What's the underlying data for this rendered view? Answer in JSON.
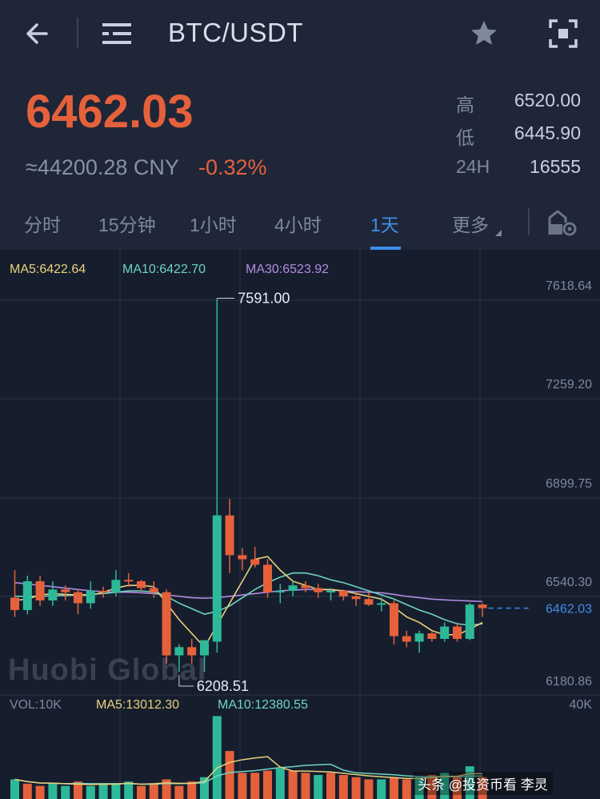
{
  "header": {
    "pair": "BTC/USDT",
    "icons": [
      "back-arrow-icon",
      "menu-icon",
      "star-icon",
      "fullscreen-icon"
    ]
  },
  "summary": {
    "last_price": "6462.03",
    "cny_price": "≈44200.28 CNY",
    "change_pct": "-0.32%",
    "high_label": "高",
    "high_value": "6520.00",
    "low_label": "低",
    "low_value": "6445.90",
    "vol24_label": "24H",
    "vol24_value": "16555"
  },
  "tabs": [
    {
      "label": "分时",
      "active": false
    },
    {
      "label": "15分钟",
      "active": false
    },
    {
      "label": "1小时",
      "active": false
    },
    {
      "label": "4小时",
      "active": false
    },
    {
      "label": "1天",
      "active": true
    },
    {
      "label": "更多",
      "active": false
    }
  ],
  "colors": {
    "up": "#2db998",
    "down": "#e5613b",
    "ma5": "#e8d07a",
    "ma10": "#6fd3c0",
    "ma30": "#b48ae0",
    "accent": "#3f8ee8"
  },
  "chart": {
    "ma5_label": "MA5:6422.64",
    "ma10_label": "MA10:6422.70",
    "ma30_label": "MA30:6523.92",
    "y_ticks": [
      "7618.64",
      "7259.20",
      "6899.75",
      "6540.30",
      "6180.86"
    ],
    "current_price_tag": "6462.03",
    "max_annotation": "7591.00",
    "min_annotation": "6208.51",
    "watermark": "Huobi Global",
    "vol_label": "VOL:10K",
    "vol_ma5_label": "MA5:13012.30",
    "vol_ma10_label": "MA10:12380.55",
    "vol_scale": "40K",
    "footer_tag": "头条 @投资币看 李灵"
  },
  "chart_data": {
    "type": "candlestick",
    "ylim": [
      6180.86,
      7618.64
    ],
    "candles": [
      {
        "o": 6500,
        "h": 6600,
        "l": 6430,
        "c": 6455
      },
      {
        "o": 6455,
        "h": 6580,
        "l": 6440,
        "c": 6560
      },
      {
        "o": 6560,
        "h": 6580,
        "l": 6470,
        "c": 6490
      },
      {
        "o": 6490,
        "h": 6560,
        "l": 6470,
        "c": 6530
      },
      {
        "o": 6530,
        "h": 6545,
        "l": 6490,
        "c": 6520
      },
      {
        "o": 6520,
        "h": 6530,
        "l": 6440,
        "c": 6480
      },
      {
        "o": 6480,
        "h": 6560,
        "l": 6460,
        "c": 6525
      },
      {
        "o": 6525,
        "h": 6540,
        "l": 6500,
        "c": 6520
      },
      {
        "o": 6520,
        "h": 6600,
        "l": 6505,
        "c": 6565
      },
      {
        "o": 6565,
        "h": 6590,
        "l": 6540,
        "c": 6560
      },
      {
        "o": 6560,
        "h": 6565,
        "l": 6520,
        "c": 6535
      },
      {
        "o": 6535,
        "h": 6560,
        "l": 6500,
        "c": 6520
      },
      {
        "o": 6520,
        "h": 6530,
        "l": 6260,
        "c": 6290
      },
      {
        "o": 6290,
        "h": 6330,
        "l": 6230,
        "c": 6320
      },
      {
        "o": 6320,
        "h": 6350,
        "l": 6260,
        "c": 6290
      },
      {
        "o": 6290,
        "h": 6340,
        "l": 6230,
        "c": 6345
      },
      {
        "o": 6340,
        "h": 7591,
        "l": 6300,
        "c": 6800
      },
      {
        "o": 6800,
        "h": 6860,
        "l": 6590,
        "c": 6655
      },
      {
        "o": 6655,
        "h": 6680,
        "l": 6600,
        "c": 6640
      },
      {
        "o": 6640,
        "h": 6685,
        "l": 6610,
        "c": 6620
      },
      {
        "o": 6620,
        "h": 6640,
        "l": 6500,
        "c": 6520
      },
      {
        "o": 6520,
        "h": 6550,
        "l": 6480,
        "c": 6525
      },
      {
        "o": 6525,
        "h": 6560,
        "l": 6505,
        "c": 6545
      },
      {
        "o": 6545,
        "h": 6560,
        "l": 6520,
        "c": 6535
      },
      {
        "o": 6535,
        "h": 6550,
        "l": 6500,
        "c": 6520
      },
      {
        "o": 6520,
        "h": 6535,
        "l": 6490,
        "c": 6525
      },
      {
        "o": 6525,
        "h": 6530,
        "l": 6490,
        "c": 6505
      },
      {
        "o": 6505,
        "h": 6520,
        "l": 6470,
        "c": 6495
      },
      {
        "o": 6495,
        "h": 6520,
        "l": 6470,
        "c": 6475
      },
      {
        "o": 6475,
        "h": 6500,
        "l": 6450,
        "c": 6480
      },
      {
        "o": 6480,
        "h": 6490,
        "l": 6330,
        "c": 6360
      },
      {
        "o": 6360,
        "h": 6380,
        "l": 6320,
        "c": 6340
      },
      {
        "o": 6340,
        "h": 6380,
        "l": 6300,
        "c": 6370
      },
      {
        "o": 6370,
        "h": 6375,
        "l": 6340,
        "c": 6350
      },
      {
        "o": 6350,
        "h": 6410,
        "l": 6340,
        "c": 6395
      },
      {
        "o": 6395,
        "h": 6410,
        "l": 6340,
        "c": 6350
      },
      {
        "o": 6350,
        "h": 6480,
        "l": 6345,
        "c": 6475
      },
      {
        "o": 6475,
        "h": 6480,
        "l": 6430,
        "c": 6462
      }
    ],
    "ma5": [
      6490,
      6495,
      6510,
      6515,
      6512,
      6510,
      6508,
      6520,
      6535,
      6545,
      6545,
      6540,
      6480,
      6420,
      6370,
      6320,
      6400,
      6480,
      6560,
      6640,
      6650,
      6600,
      6560,
      6545,
      6530,
      6530,
      6525,
      6515,
      6505,
      6495,
      6465,
      6430,
      6410,
      6380,
      6365,
      6365,
      6385,
      6410
    ],
    "ma10": [
      6505,
      6505,
      6505,
      6507,
      6508,
      6510,
      6512,
      6515,
      6520,
      6525,
      6525,
      6520,
      6505,
      6480,
      6460,
      6440,
      6450,
      6470,
      6500,
      6530,
      6555,
      6575,
      6590,
      6590,
      6580,
      6565,
      6555,
      6540,
      6525,
      6510,
      6495,
      6475,
      6455,
      6440,
      6420,
      6405,
      6400,
      6405
    ],
    "ma30": [
      6555,
      6550,
      6545,
      6540,
      6535,
      6530,
      6525,
      6522,
      6520,
      6520,
      6518,
      6515,
      6510,
      6505,
      6500,
      6498,
      6500,
      6505,
      6510,
      6515,
      6520,
      6525,
      6528,
      6530,
      6530,
      6528,
      6525,
      6522,
      6520,
      6518,
      6512,
      6505,
      6500,
      6495,
      6492,
      6490,
      6488,
      6486
    ],
    "volumes": [
      {
        "v": 9,
        "up": true
      },
      {
        "v": 7,
        "up": false
      },
      {
        "v": 6,
        "up": false
      },
      {
        "v": 7,
        "up": true
      },
      {
        "v": 6,
        "up": true
      },
      {
        "v": 8,
        "up": false
      },
      {
        "v": 6,
        "up": true
      },
      {
        "v": 7,
        "up": true
      },
      {
        "v": 7,
        "up": true
      },
      {
        "v": 8,
        "up": true
      },
      {
        "v": 6,
        "up": false
      },
      {
        "v": 7,
        "up": false
      },
      {
        "v": 9,
        "up": false
      },
      {
        "v": 6,
        "up": false
      },
      {
        "v": 8,
        "up": false
      },
      {
        "v": 10,
        "up": true
      },
      {
        "v": 38,
        "up": true
      },
      {
        "v": 22,
        "up": false
      },
      {
        "v": 12,
        "up": false
      },
      {
        "v": 12,
        "up": false
      },
      {
        "v": 13,
        "up": false
      },
      {
        "v": 14,
        "up": true
      },
      {
        "v": 13,
        "up": false
      },
      {
        "v": 12,
        "up": false
      },
      {
        "v": 11,
        "up": true
      },
      {
        "v": 12,
        "up": false
      },
      {
        "v": 11,
        "up": false
      },
      {
        "v": 10,
        "up": false
      },
      {
        "v": 9,
        "up": false
      },
      {
        "v": 9,
        "up": true
      },
      {
        "v": 10,
        "up": false
      },
      {
        "v": 9,
        "up": false
      },
      {
        "v": 10,
        "up": true
      },
      {
        "v": 11,
        "up": false
      },
      {
        "v": 12,
        "up": true
      },
      {
        "v": 10,
        "up": false
      },
      {
        "v": 15,
        "up": true
      },
      {
        "v": 10,
        "up": false
      }
    ]
  }
}
